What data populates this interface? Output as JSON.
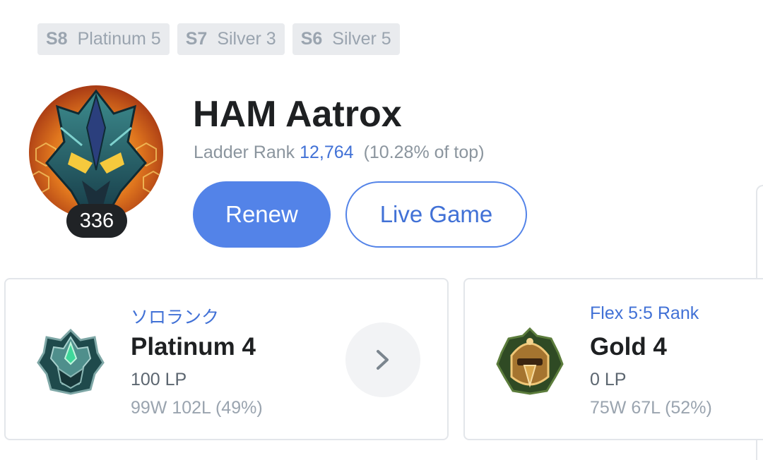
{
  "season_badges": [
    {
      "season": "S8",
      "tier": "Platinum 5"
    },
    {
      "season": "S7",
      "tier": "Silver 3"
    },
    {
      "season": "S6",
      "tier": "Silver 5"
    }
  ],
  "profile": {
    "name": "HAM Aatrox",
    "level": "336",
    "ladder_label": "Ladder Rank",
    "ladder_rank": "12,764",
    "ladder_percent": "(10.28% of top)"
  },
  "actions": {
    "renew_label": "Renew",
    "live_game_label": "Live Game"
  },
  "ranks": {
    "solo": {
      "queue": "ソロランク",
      "tier": "Platinum 4",
      "lp": "100 LP",
      "record": "99W 102L (49%)",
      "emblem_icon": "platinum-emblem-icon"
    },
    "flex": {
      "queue": "Flex 5:5 Rank",
      "tier": "Gold 4",
      "lp": "0 LP",
      "record": "75W 67L (52%)",
      "emblem_icon": "gold-emblem-icon"
    }
  },
  "colors": {
    "accent": "#5383e8",
    "accent_text": "#4171d6",
    "badge_bg": "#e9ebee"
  }
}
